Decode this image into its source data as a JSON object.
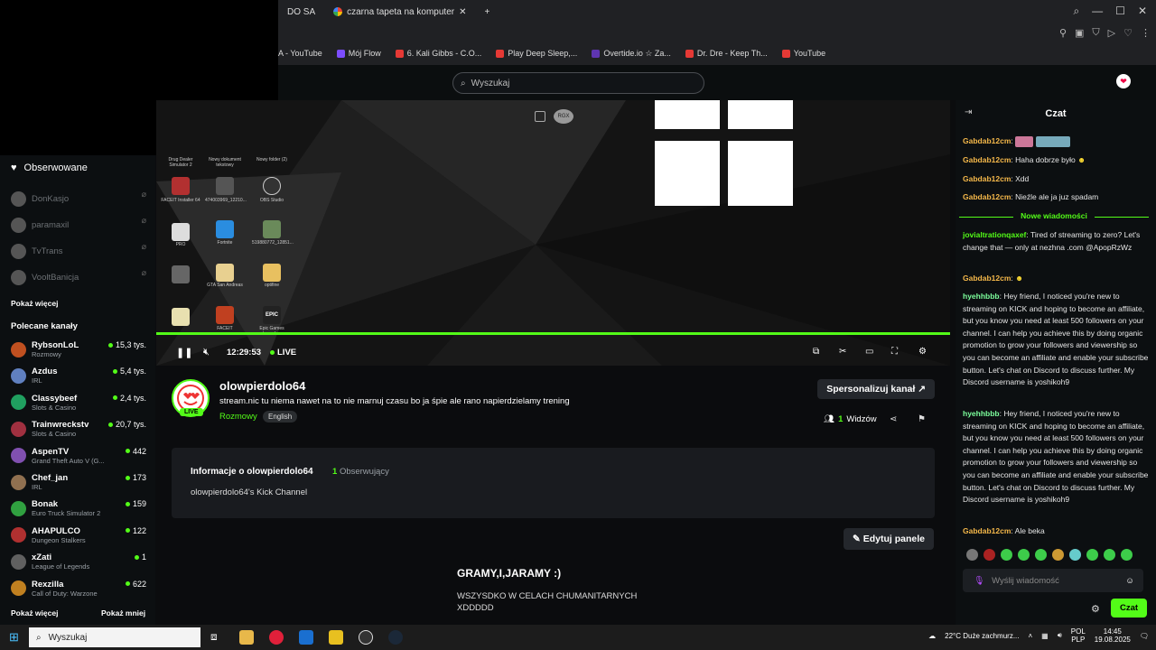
{
  "browser": {
    "tabs": [
      "DO SA",
      "czarna tapeta na komputer"
    ],
    "new_tab": "+",
    "bookmarks": [
      "A - YouTube",
      "Mój Flow",
      "6. Kali Gibbs - C.O...",
      "Play Deep Sleep,...",
      "Overtide.io ☆ Za...",
      "Dr. Dre - Keep Th...",
      "YouTube"
    ]
  },
  "kick": {
    "search_placeholder": "Wyszukaj"
  },
  "sidebar": {
    "following_title": "Obserwowane",
    "following": [
      "DonKasjo",
      "paramaxil",
      "TvTrans",
      "VooltBanicja"
    ],
    "show_more": "Pokaż więcej",
    "recommended_title": "Polecane kanały",
    "recommended": [
      {
        "name": "RybsonLoL",
        "category": "Rozmowy",
        "viewers": "15,3 tys.",
        "color": "#c05020"
      },
      {
        "name": "Azdus",
        "category": "IRL",
        "viewers": "5,4 tys.",
        "color": "#6080c0"
      },
      {
        "name": "Classybeef",
        "category": "Slots & Casino",
        "viewers": "2,4 tys.",
        "color": "#20a060"
      },
      {
        "name": "Trainwreckstv",
        "category": "Slots & Casino",
        "viewers": "20,7 tys.",
        "color": "#a03040"
      },
      {
        "name": "AspenTV",
        "category": "Grand Theft Auto V (G...",
        "viewers": "442",
        "color": "#8050b0"
      },
      {
        "name": "Chef_jan",
        "category": "IRL",
        "viewers": "173",
        "color": "#907050"
      },
      {
        "name": "Bonak",
        "category": "Euro Truck Simulator 2",
        "viewers": "159",
        "color": "#30a040"
      },
      {
        "name": "AHAPULCO",
        "category": "Dungeon Stalkers",
        "viewers": "122",
        "color": "#b03030"
      },
      {
        "name": "xZati",
        "category": "League of Legends",
        "viewers": "1",
        "color": "#606060"
      },
      {
        "name": "Rexzilla",
        "category": "Call of Duty: Warzone",
        "viewers": "622",
        "color": "#c08020"
      }
    ],
    "show_more_2": "Pokaż więcej",
    "show_less": "Pokaż mniej"
  },
  "video": {
    "time": "12:29:53",
    "live_label": "LIVE",
    "progress": 1.0,
    "desktop_icons": [
      "Drug Dealer Simulator 2",
      "Nowy dokument tekstowy",
      "Nowy folder (2)",
      "FACEIT Installer 64",
      "474003969_12210...",
      "OBS Studio",
      "PRO",
      "Fortnite",
      "519880772_12851...",
      "GTA San Andreas",
      "optifine",
      "FACEIT",
      "Epic Games Launcher"
    ]
  },
  "channel": {
    "name": "olowpierdolo64",
    "title": "stream.nic tu niema nawet na to nie marnuj czasu bo ja śpie ale rano napierdzielamy trening",
    "category": "Rozmowy",
    "language": "English",
    "live_badge": "LIVE",
    "sponsor_button": "Spersonalizuj kanał",
    "viewers_count": "1",
    "viewers_label": "Widzów"
  },
  "about": {
    "title": "Informacje o olowpierdolo64",
    "followers_count": "1",
    "followers_label": "Obserwujący",
    "description": "olowpierdolo64's Kick Channel"
  },
  "panels": {
    "edit_button": "Edytuj panele",
    "title": "GRAMY,I,JARAMY :)",
    "text": "WSZYSDKO W CELACH CHUMANITARNYCH XDDDDD"
  },
  "chat": {
    "title": "Czat",
    "new_messages": "Nowe wiadomości",
    "input_placeholder": "Wyślij wiadomość",
    "send_button": "Czat",
    "messages": [
      {
        "user": "Gabdab12cm",
        "text": ""
      },
      {
        "user": "Gabdab12cm",
        "text": "Haha dobrze było"
      },
      {
        "user": "Gabdab12cm",
        "text": "Xdd"
      },
      {
        "user": "Gabdab12cm",
        "text": "Nieźle ale ja juz spadam"
      },
      {
        "user": "jovialtrationqaxef",
        "text": "Tired of streaming to zero? Let's change that — only at nezhna .com @ApopRzWz"
      },
      {
        "user": "Gabdab12cm",
        "text": ""
      },
      {
        "user": "hyehhbbb",
        "text": "Hey friend, I noticed you're new to streaming on KICK and hoping to become an affiliate, but you know you need at least 500 followers on your channel. I can help you achieve this by doing organic promotion to grow your followers and viewership so you can become an affiliate and enable your subscribe button. Let's chat on Discord to discuss further. My Discord username is yoshikoh9"
      },
      {
        "user": "hyehhbbb",
        "text": "Hey friend, I noticed you're new to streaming on KICK and hoping to become an affiliate, but you know you need at least 500 followers on your channel. I can help you achieve this by doing organic promotion to grow your followers and viewership so you can become an affiliate and enable your subscribe button. Let's chat on Discord to discuss further. My Discord username is yoshikoh9"
      },
      {
        "user": "Gabdab12cm",
        "text": "Ale beka"
      }
    ]
  },
  "taskbar": {
    "search_placeholder": "Wyszukaj",
    "weather": "22°C  Duże zachmurz...",
    "lang_top": "POL",
    "lang_bottom": "PLP",
    "time": "14:45",
    "date": "19.08.2025"
  }
}
